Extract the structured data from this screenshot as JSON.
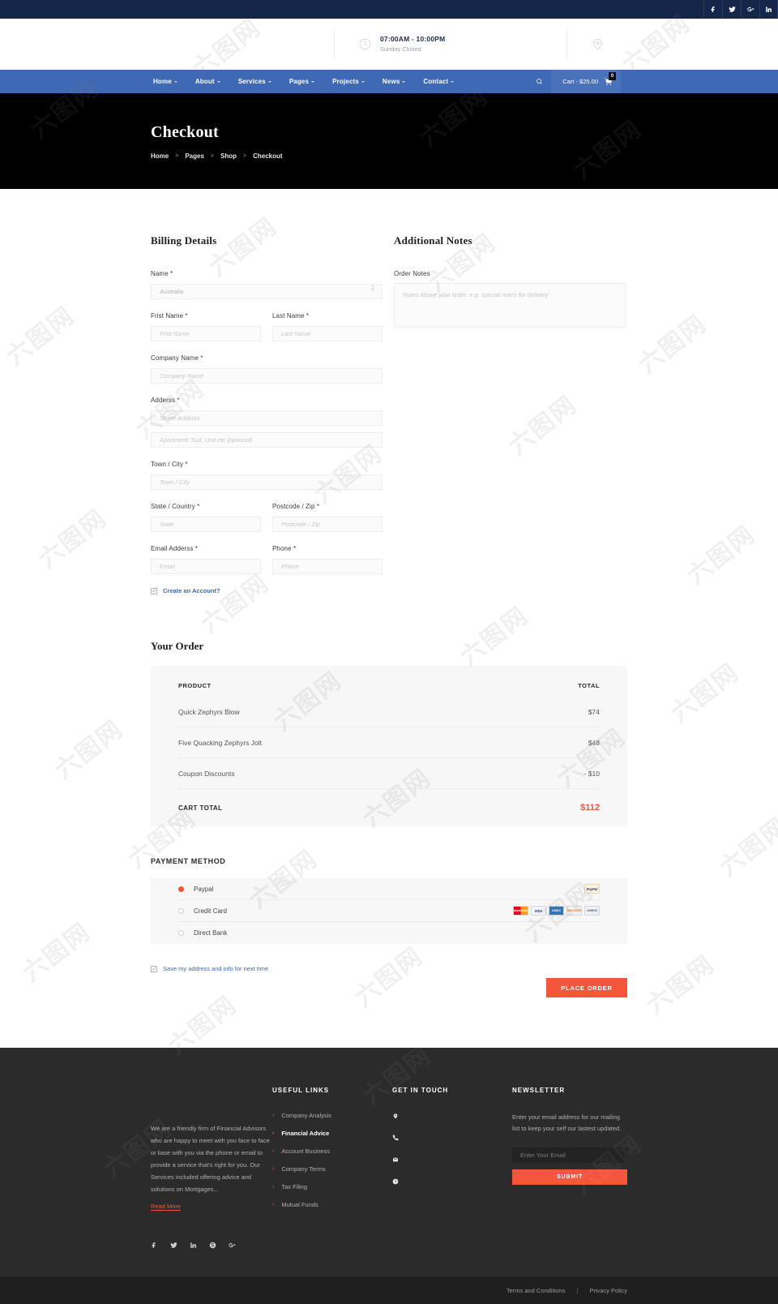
{
  "topbar": {
    "social": [
      {
        "name": "facebook-icon",
        "label": "f"
      },
      {
        "name": "twitter-icon",
        "label": "t"
      },
      {
        "name": "google-plus-icon",
        "label": "G+"
      },
      {
        "name": "linkedin-icon",
        "label": "in"
      }
    ]
  },
  "infobar": {
    "hours_title": "07:00AM - 10:00PM",
    "hours_sub": "Sunday Closed"
  },
  "nav": {
    "items": [
      {
        "label": "Home",
        "caret": true
      },
      {
        "label": "About",
        "caret": true
      },
      {
        "label": "Services",
        "caret": true
      },
      {
        "label": "Pages",
        "caret": true
      },
      {
        "label": "Projects",
        "caret": true
      },
      {
        "label": "News",
        "caret": true
      },
      {
        "label": "Contact",
        "caret": true
      }
    ],
    "cart_label": "Cart - $25.00",
    "cart_count": "0"
  },
  "hero": {
    "title": "Checkout",
    "breadcrumb": [
      "Home",
      "Pages",
      "Shop",
      "Checkout"
    ],
    "separator": ">"
  },
  "billing": {
    "title": "Billing Details",
    "name_label": "Name *",
    "name_value": "Australia",
    "first_name_label": "Frist Name *",
    "first_name_placeholder": "Frist Name",
    "last_name_label": "Last Name *",
    "last_name_placeholder": "Last Name",
    "company_label": "Company Name *",
    "company_placeholder": "Company Name",
    "address_label": "Adderss *",
    "street_placeholder": "Street Adderss",
    "apartment_placeholder": "Apartment, Suit, Unit etc (optional)",
    "town_label": "Town / City *",
    "town_placeholder": "Town / City",
    "state_label": "State / Country *",
    "state_placeholder": "State",
    "postcode_label": "Postcode / Zip *",
    "postcode_placeholder": "Postcode / Zip",
    "email_label": "Email Adderss *",
    "email_placeholder": "Email",
    "phone_label": "Phone *",
    "phone_placeholder": "Phone",
    "create_account_label": "Create an Account?"
  },
  "notes": {
    "title": "Additional Notes",
    "order_notes_label": "Order Notes",
    "order_notes_placeholder": "Notes above your order. e.g. special notes for delivery"
  },
  "order": {
    "title": "Your Order",
    "columns": [
      "PRODUCT",
      "TOTAL"
    ],
    "rows": [
      {
        "product": "Quick Zephyrs Blow",
        "total": "$74"
      },
      {
        "product": "Five Quacking Zephyrs Jolt",
        "total": "$48"
      },
      {
        "product": "Coupon Discounts",
        "total": "- $10"
      }
    ],
    "total_label": "CART TOTAL",
    "total_value": "$112",
    "total_color": "#f4563c"
  },
  "payment": {
    "title": "PAYMENT METHOD",
    "methods": [
      {
        "label": "Paypal",
        "selected": true,
        "logos": [
          "PayPal"
        ]
      },
      {
        "label": "Credit Card",
        "selected": false,
        "logos": [
          "MasterCard",
          "VISA",
          "AMEX",
          "DISCOVER",
          "eCHECK"
        ]
      },
      {
        "label": "Direct Bank",
        "selected": false,
        "logos": []
      }
    ],
    "save_label": "Save my address and info for next time",
    "place_order_label": "PLACE ORDER"
  },
  "footer": {
    "about_text": "We are a friendly firm of Financial Advisors who are happy to meet with you face to face or liase with you via the phone or email to provide a service that's right for you. Our Services included offering advice and solutions on Mortgages...",
    "read_more": "Read More",
    "social": [
      {
        "name": "facebook-icon"
      },
      {
        "name": "twitter-icon"
      },
      {
        "name": "linkedin-icon"
      },
      {
        "name": "skype-icon"
      },
      {
        "name": "google-plus-icon"
      }
    ],
    "links_title": "USEFUL LINKS",
    "links": [
      {
        "label": "Company Analysis",
        "active": false
      },
      {
        "label": "Financial Advice",
        "active": true
      },
      {
        "label": "Account Business",
        "active": false
      },
      {
        "label": "Company Terms",
        "active": false
      },
      {
        "label": "Tax Filing",
        "active": false
      },
      {
        "label": "Mutual Funds",
        "active": false
      }
    ],
    "touch_title": "GET IN TOUCH",
    "touch_items": [
      {
        "icon": "location-pin-icon",
        "text": ""
      },
      {
        "icon": "phone-icon",
        "text": ""
      },
      {
        "icon": "envelope-icon",
        "text": ""
      },
      {
        "icon": "clock-icon",
        "text": ""
      }
    ],
    "newsletter_title": "NEWSLETTER",
    "newsletter_desc": "Enter your email address for our mailing list to keep your self our lastest updated.",
    "newsletter_placeholder": "Enter Your Email",
    "submit_label": "SUBMIT"
  },
  "bottombar": {
    "terms": "Terms and Conditions",
    "divider": "|",
    "privacy": "Privacy Policy"
  },
  "watermark": {
    "text": "六图网"
  },
  "colors": {
    "navy": "#16264b",
    "blue": "#4069b5",
    "accent": "#f4563c",
    "dark": "#2b2b2b"
  }
}
